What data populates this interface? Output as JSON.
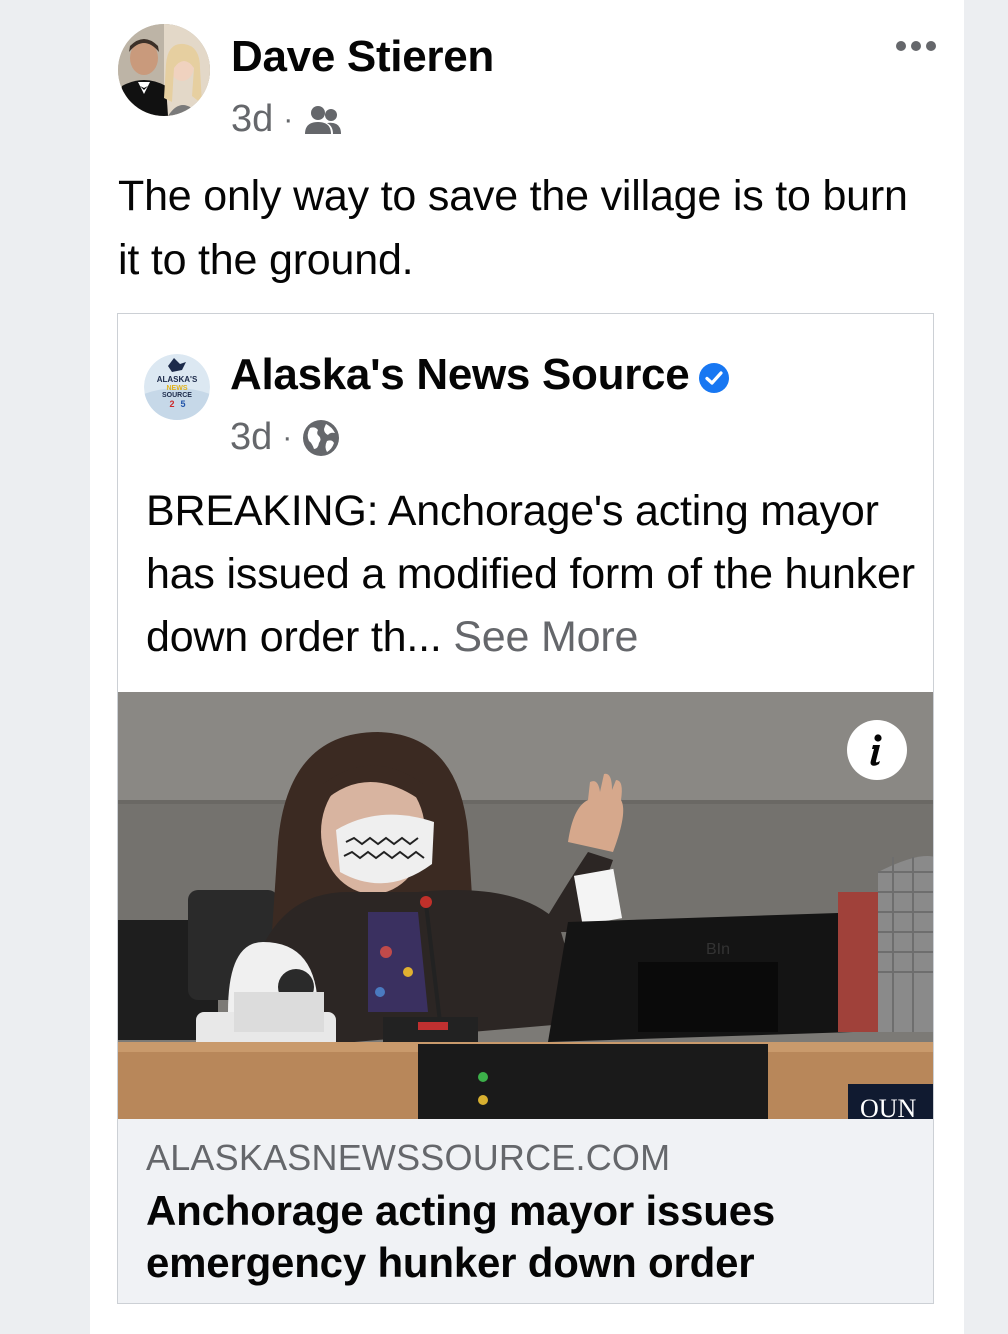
{
  "post": {
    "author_name": "Dave Stieren",
    "time": "3d",
    "separator": "·",
    "audience_icon": "friends-icon",
    "more_icon": "more-horizontal-icon",
    "text": "The only way to save the village is to burn it to the ground."
  },
  "shared_post": {
    "page_name": "Alaska's News Source",
    "verified_icon": "verified-badge-icon",
    "time": "3d",
    "separator": "·",
    "audience_icon": "globe-icon",
    "text": "BREAKING: Anchorage's acting mayor has issued a modified form of the hunker down order th...",
    "see_more_label": "See More",
    "logo_text": {
      "line1": "ALASKA'S",
      "line2": "NEWS",
      "line3": "SOURCE",
      "line4": "2",
      "line5": "5"
    }
  },
  "link_preview": {
    "domain": "ALASKASNEWSSOURCE.COM",
    "headline": "Anchorage acting mayor issues emergency hunker down order",
    "info_icon": "info-icon",
    "photo_sign_text": "OUN"
  },
  "colors": {
    "primary_text": "#050505",
    "secondary_text": "#65676b",
    "verified_blue": "#1877f2",
    "footer_bg": "#f0f2f5"
  }
}
